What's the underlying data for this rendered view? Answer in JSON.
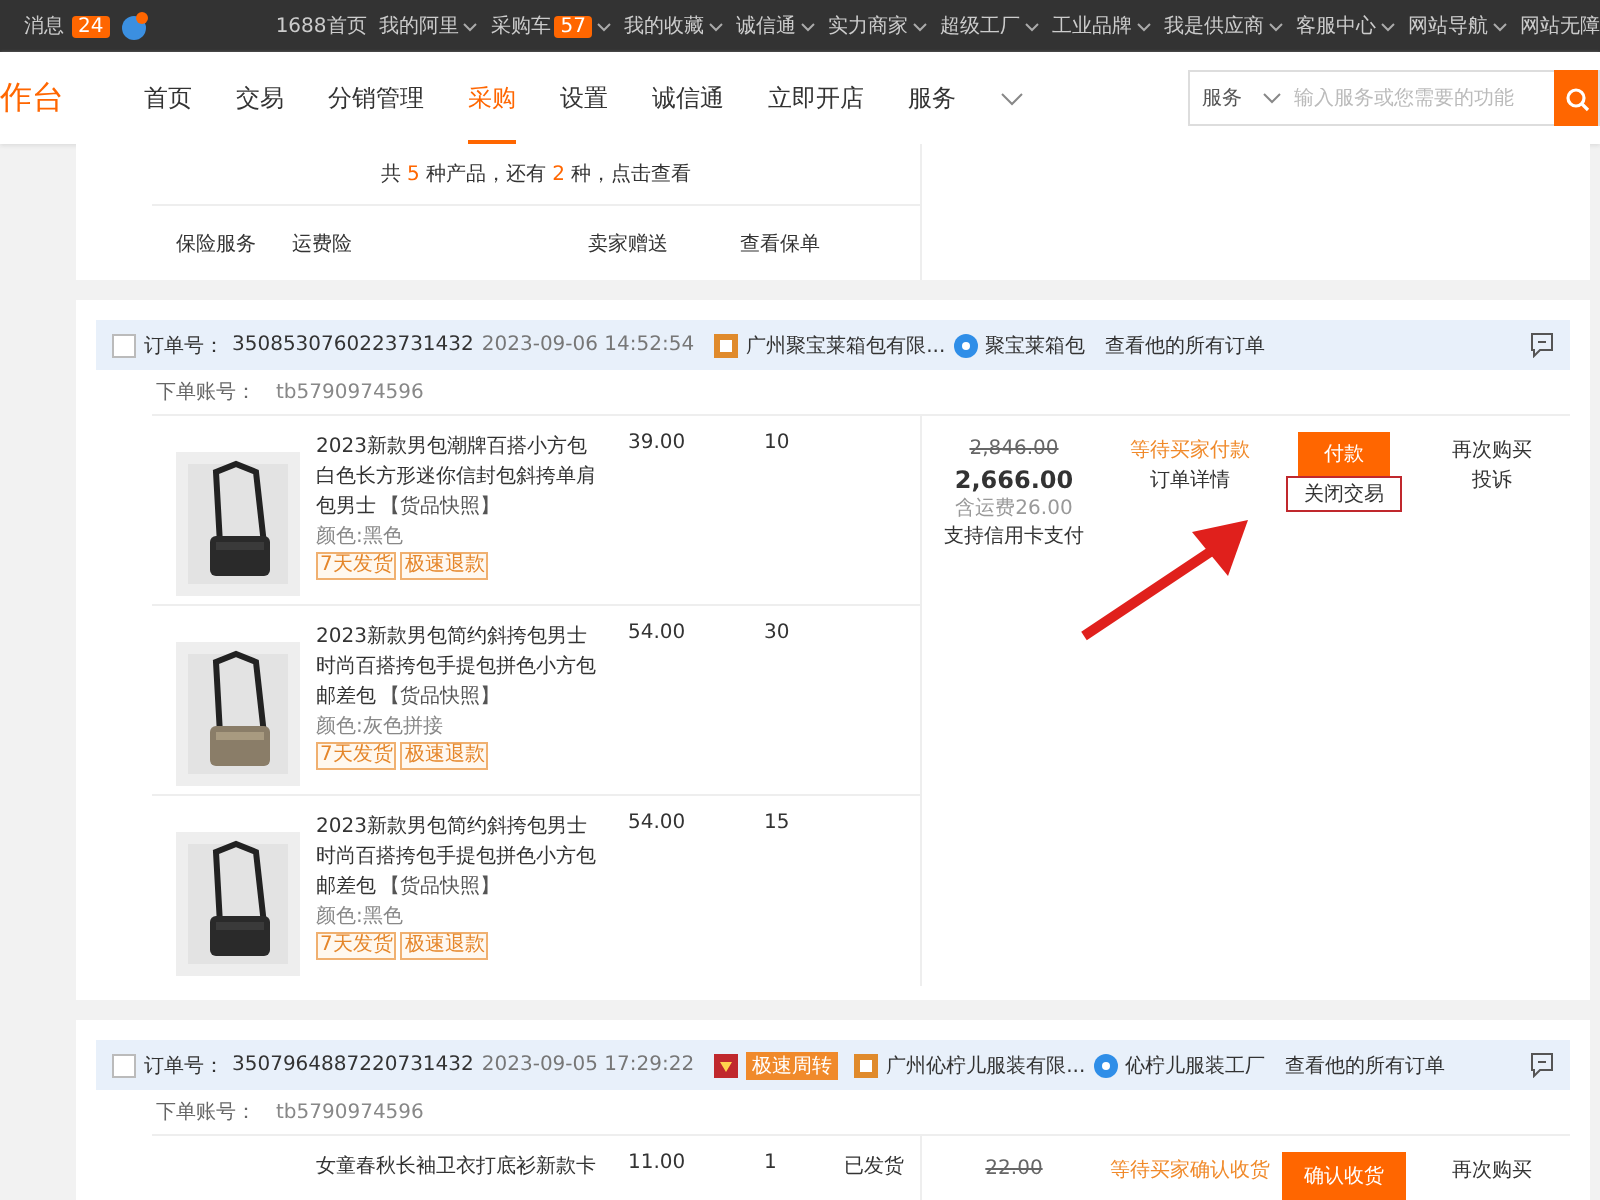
{
  "top_bar": {
    "message_label": "消息",
    "message_count": "24",
    "links": [
      {
        "label": "1688首页",
        "dropdown": false
      },
      {
        "label": "我的阿里",
        "dropdown": true
      },
      {
        "label": "采购车",
        "count": "57",
        "dropdown": true
      },
      {
        "label": "我的收藏",
        "dropdown": true
      },
      {
        "label": "诚信通",
        "dropdown": true
      },
      {
        "label": "实力商家",
        "dropdown": true
      },
      {
        "label": "超级工厂",
        "dropdown": true
      },
      {
        "label": "工业品牌",
        "dropdown": true
      },
      {
        "label": "我是供应商",
        "dropdown": true
      },
      {
        "label": "客服中心",
        "dropdown": true
      },
      {
        "label": "网站导航",
        "dropdown": true
      },
      {
        "label": "网站无障",
        "dropdown": false
      }
    ]
  },
  "nav": {
    "logo": "作台",
    "tabs": [
      {
        "label": "首页",
        "selected": false
      },
      {
        "label": "交易",
        "selected": false
      },
      {
        "label": "分销管理",
        "selected": false
      },
      {
        "label": "采购",
        "selected": true
      },
      {
        "label": "设置",
        "selected": false
      },
      {
        "label": "诚信通",
        "selected": false
      },
      {
        "label": "立即开店",
        "selected": false
      },
      {
        "label": "服务",
        "selected": false
      }
    ],
    "search": {
      "scope": "服务",
      "placeholder": "输入服务或您需要的功能"
    }
  },
  "summary_card": {
    "summary": "共 **5** 种产品，还有 **2** 种，点击查看",
    "services": [
      "保险服务",
      "运费险",
      "卖家赠送",
      "查看保单"
    ]
  },
  "orders": [
    {
      "checked": false,
      "order_no_label": "订单号：",
      "order_no": "3508530760223731432",
      "time": "2023-09-06 14:52:54",
      "shop": "广州聚宝莱箱包有限...",
      "seller": "聚宝莱箱包",
      "all_orders": "查看他的所有订单",
      "account_label": "下单账号：",
      "account": "tb5790974596",
      "products": [
        {
          "title": "2023新款男包潮牌百搭小方包白色长方形迷你信封包斜挎单肩包男士",
          "snapshot": "【货品快照】",
          "variant": "颜色:黑色",
          "price": "39.00",
          "qty": "10",
          "badges": [
            "7天发货",
            "极速退款"
          ],
          "image": {
            "kind": "picture"
          }
        },
        {
          "title": "2023新款男包简约斜挎包男士时尚百搭挎包手提包拼色小方包邮差包",
          "snapshot": "【货品快照】",
          "variant": "颜色:灰色拼接",
          "price": "54.00",
          "qty": "30",
          "badges": [
            "7天发货",
            "极速退款"
          ],
          "image": {
            "kind": "picture"
          }
        },
        {
          "title": "2023新款男包简约斜挎包男士时尚百搭挎包手提包拼色小方包邮差包",
          "snapshot": "【货品快照】",
          "variant": "颜色:黑色",
          "price": "54.00",
          "qty": "15",
          "badges": [
            "7天发货",
            "极速退款"
          ],
          "image": {
            "kind": "picture"
          }
        }
      ],
      "total": {
        "original": "2,846.00",
        "amount": "2,666.00",
        "shipping": "含运费26.00",
        "note": "支持信用卡支付"
      },
      "status": "等待买家付款",
      "detail": "订单详情",
      "actions": [
        {
          "label": "付款",
          "kind": "primary"
        },
        {
          "label": "关闭交易",
          "kind": "highlighted"
        }
      ],
      "links": [
        "再次购买",
        "投诉"
      ]
    },
    {
      "checked": false,
      "order_no_label": "订单号：",
      "order_no": "3507964887220731432",
      "time": "2023-09-05 17:29:22",
      "tags": [
        "极速周转"
      ],
      "shop": "广州伈柠儿服装有限...",
      "seller": "伈柠儿服装工厂",
      "all_orders": "查看他的所有订单",
      "account_label": "下单账号：",
      "account": "tb5790974596",
      "products": [
        {
          "title": "女童春秋长袖卫衣打底衫新款卡",
          "price": "11.00",
          "qty": "1",
          "ship_status": "已发货"
        }
      ],
      "total": {
        "original": "22.00"
      },
      "status": "等待买家确认收货",
      "actions": [
        {
          "label": "确认收货",
          "kind": "primary"
        }
      ],
      "links": [
        "再次购买"
      ]
    }
  ]
}
